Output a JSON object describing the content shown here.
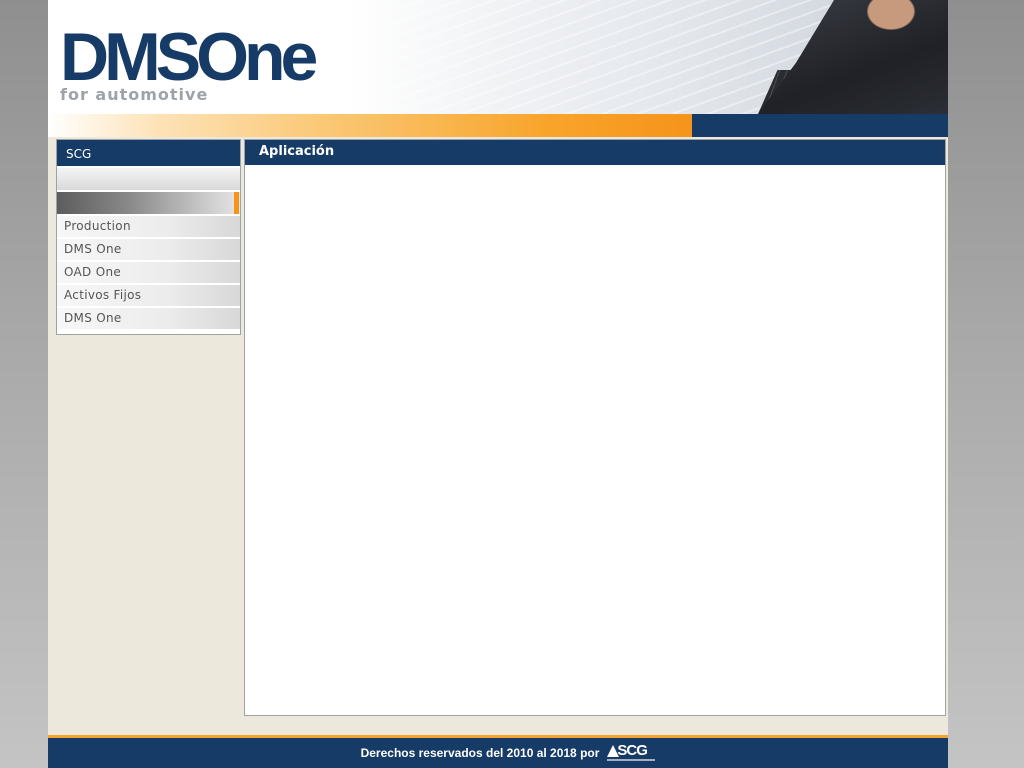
{
  "header": {
    "logo_main": "DMSOne",
    "logo_sub": "for automotive"
  },
  "sidebar": {
    "title": "SCG",
    "items": [
      {
        "label": "Production"
      },
      {
        "label": "DMS  One"
      },
      {
        "label": "OAD One"
      },
      {
        "label": "Activos Fijos"
      },
      {
        "label": "DMS  One"
      }
    ]
  },
  "main": {
    "title": "Aplicación"
  },
  "footer": {
    "text": "Derechos reservados del 2010 al 2018 por",
    "logo_text": "SCG"
  },
  "colors": {
    "navy": "#163b67",
    "orange": "#f6931a",
    "panel_bg": "#ece9dc"
  }
}
